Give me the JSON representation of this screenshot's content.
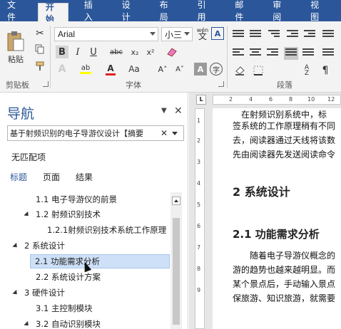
{
  "menu_tabs": [
    "文件",
    "开始",
    "插入",
    "设计",
    "布局",
    "引用",
    "邮件",
    "审阅",
    "视图"
  ],
  "active_tab": "开始",
  "ribbon": {
    "clipboard": {
      "paste_label": "粘贴",
      "group_label": "剪贴板"
    },
    "font": {
      "font_name": "Arial",
      "font_size": "小三",
      "wen_label": "wén",
      "bold": "B",
      "italic": "I",
      "underline": "U",
      "strike": "abc",
      "subscript": "x₂",
      "superscript": "x²",
      "highlight": "ab",
      "font_color": "A",
      "font_aa": "Aa",
      "grow": "A˄",
      "shrink": "A˅",
      "clear": "A",
      "group_label": "字体"
    },
    "paragraph": {
      "group_label": "段落"
    }
  },
  "nav_pane": {
    "title": "导航",
    "search_value": "基于射频识别的电子导游仪设计【摘要",
    "no_match": "无匹配项",
    "tabs": [
      "标题",
      "页面",
      "结果"
    ],
    "outline": [
      {
        "text": "1.1 电子导游仪的前景",
        "indent": 2,
        "collapsible": false,
        "selected": false
      },
      {
        "text": "1.2 射频识别技术",
        "indent": 2,
        "collapsible": true,
        "selected": false
      },
      {
        "text": "1.2.1射频识别技术系统工作原理",
        "indent": 3,
        "collapsible": false,
        "selected": false
      },
      {
        "text": "2 系统设计",
        "indent": 1,
        "collapsible": true,
        "selected": false
      },
      {
        "text": "2.1 功能需求分析",
        "indent": 2,
        "collapsible": false,
        "selected": true
      },
      {
        "text": "2.2 系统设计方案",
        "indent": 2,
        "collapsible": false,
        "selected": false
      },
      {
        "text": "3 硬件设计",
        "indent": 1,
        "collapsible": true,
        "selected": false
      },
      {
        "text": "3.1 主控制模块",
        "indent": 2,
        "collapsible": false,
        "selected": false
      },
      {
        "text": "3.2 自动识别模块",
        "indent": 2,
        "collapsible": true,
        "selected": false
      }
    ]
  },
  "ruler": {
    "corner": "L",
    "h_ticks": [
      "2",
      "4",
      "6",
      "8",
      "10",
      "12"
    ],
    "v_ticks": [
      "1",
      "2",
      "3",
      "4",
      "5",
      "6",
      "7",
      "8",
      "9"
    ]
  },
  "document": {
    "lines_top": [
      "在射频识别系统中，标",
      "签系统的工作原理稍有不同",
      "去，阅读器通过天线将该数",
      "先由阅读器先发送阅读命令"
    ],
    "heading1": "2  系统设计",
    "heading2": "2.1  功能需求分析",
    "lines_bottom": [
      "随着电子导游仪概念的",
      "游的趋势也越来越明显。而",
      "某个景点后，手动输入景点",
      "保旅游、知识旅游，就需要"
    ]
  }
}
